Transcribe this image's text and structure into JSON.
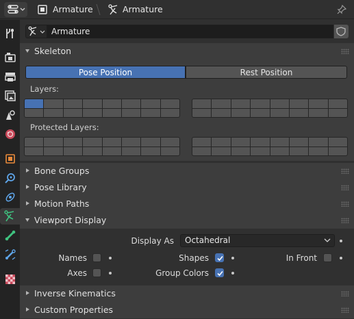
{
  "header": {
    "object_name": "Armature",
    "data_name": "Armature"
  },
  "sidebar": {
    "tabs": [
      {
        "name": "tool",
        "icon": "wrench-screwdriver-icon"
      },
      {
        "name": "render",
        "icon": "camera-back-icon"
      },
      {
        "name": "output",
        "icon": "printer-icon"
      },
      {
        "name": "view-layer",
        "icon": "image-stack-icon"
      },
      {
        "name": "scene",
        "icon": "scene-cone-sphere-icon"
      },
      {
        "name": "world",
        "icon": "world-globe-icon"
      },
      {
        "name": "object",
        "icon": "object-square-icon"
      },
      {
        "name": "modifiers",
        "icon": "wrench-icon"
      },
      {
        "name": "physics",
        "icon": "physics-orbit-icon"
      },
      {
        "name": "object-data",
        "icon": "armature-stick-figure-icon"
      },
      {
        "name": "bone",
        "icon": "bone-icon"
      },
      {
        "name": "bone-constraints",
        "icon": "bone-constraint-icon"
      },
      {
        "name": "texture",
        "icon": "checker-texture-icon"
      }
    ],
    "active_tab": "object-data"
  },
  "datablock": {
    "name": "Armature"
  },
  "skeleton": {
    "title": "Skeleton",
    "pose_position": "Pose Position",
    "rest_position": "Rest Position",
    "layers_label": "Layers:",
    "protected_layers_label": "Protected Layers:"
  },
  "panels": {
    "bone_groups": "Bone Groups",
    "pose_library": "Pose Library",
    "motion_paths": "Motion Paths",
    "viewport_display": "Viewport Display",
    "inverse_kinematics": "Inverse Kinematics",
    "custom_properties": "Custom Properties"
  },
  "viewport_display": {
    "display_as_label": "Display As",
    "display_as_value": "Octahedral",
    "names_label": "Names",
    "names_checked": false,
    "shapes_label": "Shapes",
    "shapes_checked": true,
    "in_front_label": "In Front",
    "in_front_checked": false,
    "axes_label": "Axes",
    "axes_checked": false,
    "group_colors_label": "Group Colors",
    "group_colors_checked": true
  },
  "colors": {
    "accent": "#4772b3",
    "armature_icon": "#3fc27f"
  }
}
